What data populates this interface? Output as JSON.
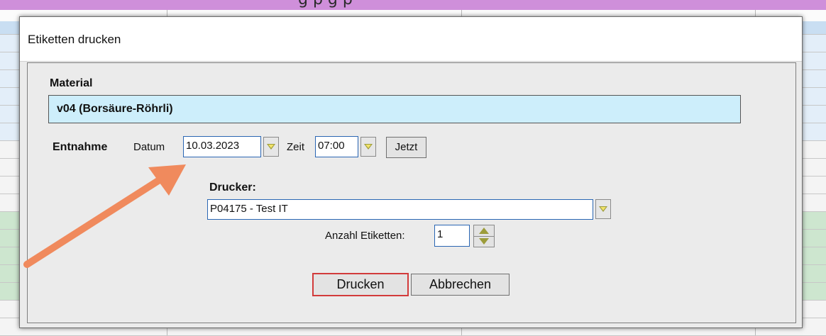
{
  "background": {
    "top_text": "g                                      p                        g p"
  },
  "dialog": {
    "title": "Etiketten drucken",
    "material_label": "Material",
    "material_value": "v04 (Borsäure-Röhrli)",
    "entnahme_label": "Entnahme",
    "datum_label": "Datum",
    "datum_value": "10.03.2023",
    "zeit_label": "Zeit",
    "zeit_value": "07:00",
    "jetzt_button": "Jetzt",
    "drucker_label": "Drucker:",
    "drucker_value": "P04175 - Test IT",
    "anzahl_label": "Anzahl Etiketten:",
    "anzahl_value": "1",
    "drucken_button": "Drucken",
    "abbrechen_button": "Abbrechen"
  },
  "colors": {
    "accent_arrow": "#f08a5d",
    "material_box": "#cdeefb",
    "primary_border": "#d23b3b",
    "title_band": "#cf8fda"
  },
  "icons": {
    "dropdown": "chevron-down-icon",
    "spinner_up": "spin-up-icon",
    "spinner_down": "spin-down-icon",
    "annotation": "arrow-annotation-icon"
  }
}
